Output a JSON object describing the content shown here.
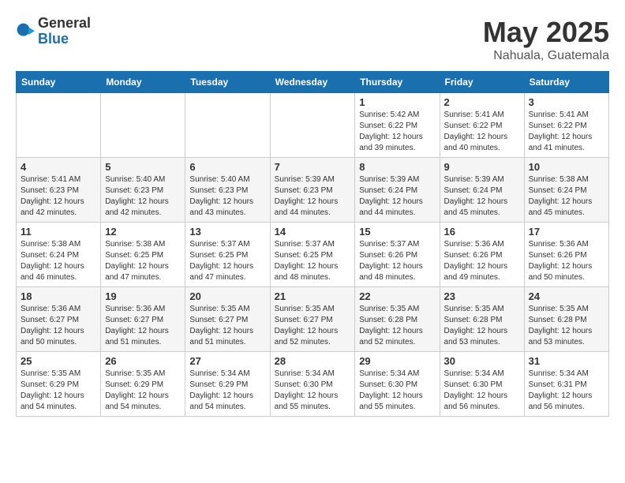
{
  "logo": {
    "general": "General",
    "blue": "Blue"
  },
  "title": {
    "month_year": "May 2025",
    "location": "Nahuala, Guatemala"
  },
  "days_of_week": [
    "Sunday",
    "Monday",
    "Tuesday",
    "Wednesday",
    "Thursday",
    "Friday",
    "Saturday"
  ],
  "weeks": [
    [
      {
        "day": "",
        "info": ""
      },
      {
        "day": "",
        "info": ""
      },
      {
        "day": "",
        "info": ""
      },
      {
        "day": "",
        "info": ""
      },
      {
        "day": "1",
        "info": "Sunrise: 5:42 AM\nSunset: 6:22 PM\nDaylight: 12 hours\nand 39 minutes."
      },
      {
        "day": "2",
        "info": "Sunrise: 5:41 AM\nSunset: 6:22 PM\nDaylight: 12 hours\nand 40 minutes."
      },
      {
        "day": "3",
        "info": "Sunrise: 5:41 AM\nSunset: 6:22 PM\nDaylight: 12 hours\nand 41 minutes."
      }
    ],
    [
      {
        "day": "4",
        "info": "Sunrise: 5:41 AM\nSunset: 6:23 PM\nDaylight: 12 hours\nand 42 minutes."
      },
      {
        "day": "5",
        "info": "Sunrise: 5:40 AM\nSunset: 6:23 PM\nDaylight: 12 hours\nand 42 minutes."
      },
      {
        "day": "6",
        "info": "Sunrise: 5:40 AM\nSunset: 6:23 PM\nDaylight: 12 hours\nand 43 minutes."
      },
      {
        "day": "7",
        "info": "Sunrise: 5:39 AM\nSunset: 6:23 PM\nDaylight: 12 hours\nand 44 minutes."
      },
      {
        "day": "8",
        "info": "Sunrise: 5:39 AM\nSunset: 6:24 PM\nDaylight: 12 hours\nand 44 minutes."
      },
      {
        "day": "9",
        "info": "Sunrise: 5:39 AM\nSunset: 6:24 PM\nDaylight: 12 hours\nand 45 minutes."
      },
      {
        "day": "10",
        "info": "Sunrise: 5:38 AM\nSunset: 6:24 PM\nDaylight: 12 hours\nand 45 minutes."
      }
    ],
    [
      {
        "day": "11",
        "info": "Sunrise: 5:38 AM\nSunset: 6:24 PM\nDaylight: 12 hours\nand 46 minutes."
      },
      {
        "day": "12",
        "info": "Sunrise: 5:38 AM\nSunset: 6:25 PM\nDaylight: 12 hours\nand 47 minutes."
      },
      {
        "day": "13",
        "info": "Sunrise: 5:37 AM\nSunset: 6:25 PM\nDaylight: 12 hours\nand 47 minutes."
      },
      {
        "day": "14",
        "info": "Sunrise: 5:37 AM\nSunset: 6:25 PM\nDaylight: 12 hours\nand 48 minutes."
      },
      {
        "day": "15",
        "info": "Sunrise: 5:37 AM\nSunset: 6:26 PM\nDaylight: 12 hours\nand 48 minutes."
      },
      {
        "day": "16",
        "info": "Sunrise: 5:36 AM\nSunset: 6:26 PM\nDaylight: 12 hours\nand 49 minutes."
      },
      {
        "day": "17",
        "info": "Sunrise: 5:36 AM\nSunset: 6:26 PM\nDaylight: 12 hours\nand 50 minutes."
      }
    ],
    [
      {
        "day": "18",
        "info": "Sunrise: 5:36 AM\nSunset: 6:27 PM\nDaylight: 12 hours\nand 50 minutes."
      },
      {
        "day": "19",
        "info": "Sunrise: 5:36 AM\nSunset: 6:27 PM\nDaylight: 12 hours\nand 51 minutes."
      },
      {
        "day": "20",
        "info": "Sunrise: 5:35 AM\nSunset: 6:27 PM\nDaylight: 12 hours\nand 51 minutes."
      },
      {
        "day": "21",
        "info": "Sunrise: 5:35 AM\nSunset: 6:27 PM\nDaylight: 12 hours\nand 52 minutes."
      },
      {
        "day": "22",
        "info": "Sunrise: 5:35 AM\nSunset: 6:28 PM\nDaylight: 12 hours\nand 52 minutes."
      },
      {
        "day": "23",
        "info": "Sunrise: 5:35 AM\nSunset: 6:28 PM\nDaylight: 12 hours\nand 53 minutes."
      },
      {
        "day": "24",
        "info": "Sunrise: 5:35 AM\nSunset: 6:28 PM\nDaylight: 12 hours\nand 53 minutes."
      }
    ],
    [
      {
        "day": "25",
        "info": "Sunrise: 5:35 AM\nSunset: 6:29 PM\nDaylight: 12 hours\nand 54 minutes."
      },
      {
        "day": "26",
        "info": "Sunrise: 5:35 AM\nSunset: 6:29 PM\nDaylight: 12 hours\nand 54 minutes."
      },
      {
        "day": "27",
        "info": "Sunrise: 5:34 AM\nSunset: 6:29 PM\nDaylight: 12 hours\nand 54 minutes."
      },
      {
        "day": "28",
        "info": "Sunrise: 5:34 AM\nSunset: 6:30 PM\nDaylight: 12 hours\nand 55 minutes."
      },
      {
        "day": "29",
        "info": "Sunrise: 5:34 AM\nSunset: 6:30 PM\nDaylight: 12 hours\nand 55 minutes."
      },
      {
        "day": "30",
        "info": "Sunrise: 5:34 AM\nSunset: 6:30 PM\nDaylight: 12 hours\nand 56 minutes."
      },
      {
        "day": "31",
        "info": "Sunrise: 5:34 AM\nSunset: 6:31 PM\nDaylight: 12 hours\nand 56 minutes."
      }
    ]
  ]
}
